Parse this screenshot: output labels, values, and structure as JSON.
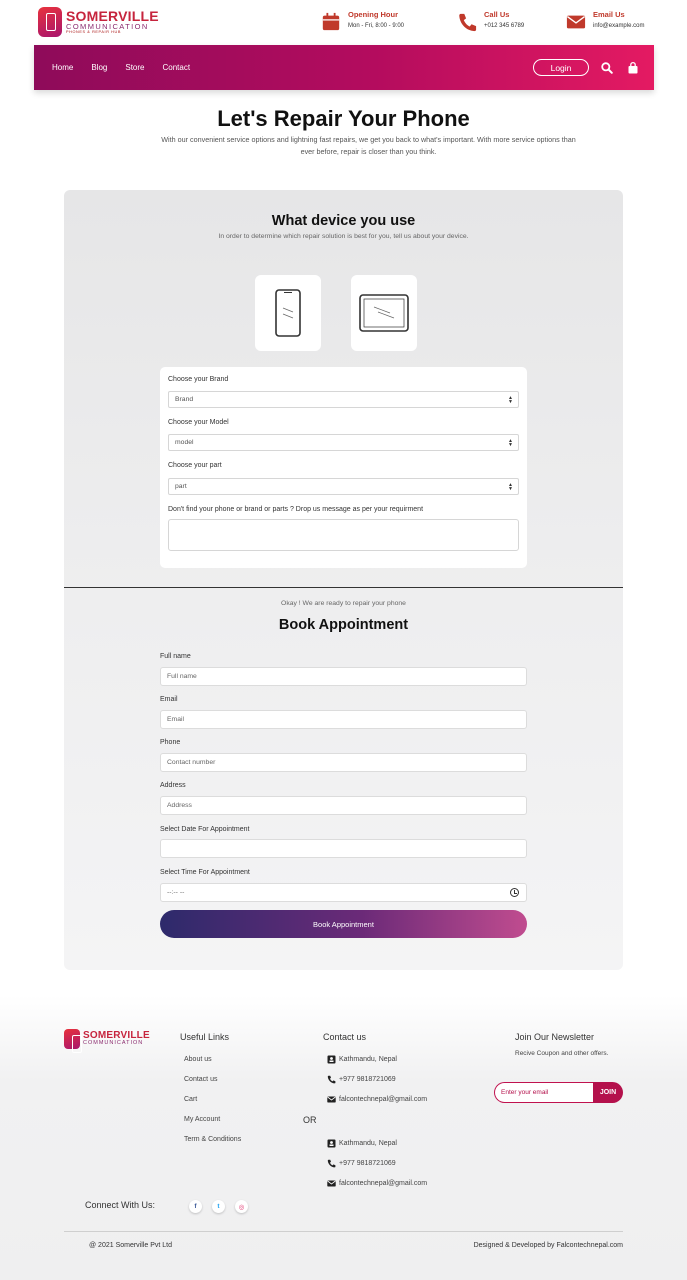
{
  "brand": {
    "name": "SOMERVILLE",
    "sub": "COMMUNICATION",
    "tagline": "PHONES & REPAIR HUB"
  },
  "header_info": [
    {
      "icon": "calendar-icon",
      "title": "Opening Hour",
      "value": "Mon - Fri, 8:00 - 9:00"
    },
    {
      "icon": "phone-icon",
      "title": "Call Us",
      "value": "+012 345 6789"
    },
    {
      "icon": "envelope-icon",
      "title": "Email Us",
      "value": "info@example.com"
    }
  ],
  "nav": {
    "links": [
      "Home",
      "Blog",
      "Store",
      "Contact"
    ],
    "login_label": "Login",
    "icons": [
      "search-icon",
      "shopping-bag-icon"
    ]
  },
  "hero": {
    "title": "Let's Repair Your Phone",
    "description": "With our convenient service options and lightning fast repairs, we get you back to what's important. With more service options than ever before, repair is closer than you think."
  },
  "device_section": {
    "title": "What device you use",
    "subtitle": "In order to determine which repair solution is best for you, tell us about your device.",
    "devices": [
      "smartphone-icon",
      "tablet-icon"
    ]
  },
  "device_form": {
    "brand_label": "Choose your Brand",
    "brand_value": "Brand",
    "model_label": "Choose your Model",
    "model_value": "model",
    "part_label": "Choose your part",
    "part_value": "part",
    "message_label": "Don't find your phone or brand or parts ? Drop us message as per your requirment"
  },
  "appointment": {
    "kicker": "Okay ! We are ready to repair your phone",
    "title": "Book Appointment",
    "fields": {
      "full_name_label": "Full name",
      "full_name_placeholder": "Full name",
      "email_label": "Email",
      "email_placeholder": "Email",
      "phone_label": "Phone",
      "phone_placeholder": "Contact number",
      "address_label": "Address",
      "address_placeholder": "Address",
      "date_label": "Select Date For Appointment",
      "time_label": "Select Time For Appointment",
      "time_value": "--:-- --"
    },
    "button_label": "Book Appointment"
  },
  "footer": {
    "useful_links_title": "Useful Links",
    "useful_links": [
      "About us",
      "Contact us",
      "Cart",
      "My Account",
      "Term & Conditions"
    ],
    "contact_title": "Contact us",
    "contact_group_1": {
      "address": "Kathmandu, Nepal",
      "phone": "+977 9818721069",
      "email": "falcontechnepal@gmail.com"
    },
    "or_label": "OR",
    "contact_group_2": {
      "address": "Kathmandu, Nepal",
      "phone": "+977 9818721069",
      "email": "falcontechnepal@gmail.com"
    },
    "newsletter_title": "Join Our Newsletter",
    "newsletter_text": "Recive Coupon and other offers.",
    "newsletter_placeholder": "Enter your email",
    "newsletter_button": "JOIN",
    "connect_label": "Connect With Us:",
    "social": [
      "facebook-icon",
      "twitter-icon",
      "instagram-icon"
    ],
    "copyright": "@ 2021 Somerville Pvt Ltd",
    "credit": "Designed & Developed by Falcontechnepal.com"
  },
  "colors": {
    "brand_red": "#c6243d",
    "nav_start": "#8e0b5a",
    "nav_end": "#e41a62",
    "button_start": "#2d2a6b",
    "button_end": "#c04c8f",
    "join_button": "#b4114c"
  }
}
